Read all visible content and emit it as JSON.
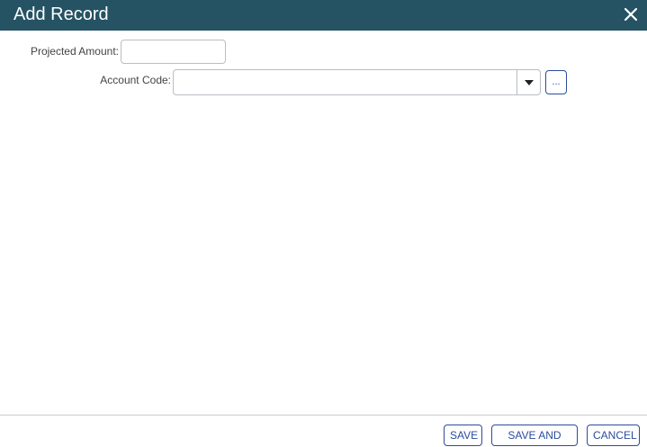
{
  "dialog": {
    "title": "Add Record"
  },
  "form": {
    "projected_amount": {
      "label": "Projected Amount:",
      "value": ""
    },
    "account_code": {
      "label": "Account Code:",
      "value": "",
      "lookup_label": "..."
    }
  },
  "footer": {
    "save_label": "SAVE",
    "save_and_add_label": "SAVE AND ADD",
    "cancel_label": "CANCEL"
  },
  "colors": {
    "titlebar": "#255363",
    "accent": "#2b4c9b"
  },
  "icons": {
    "close": "close-icon",
    "dropdown": "caret-down-icon"
  }
}
